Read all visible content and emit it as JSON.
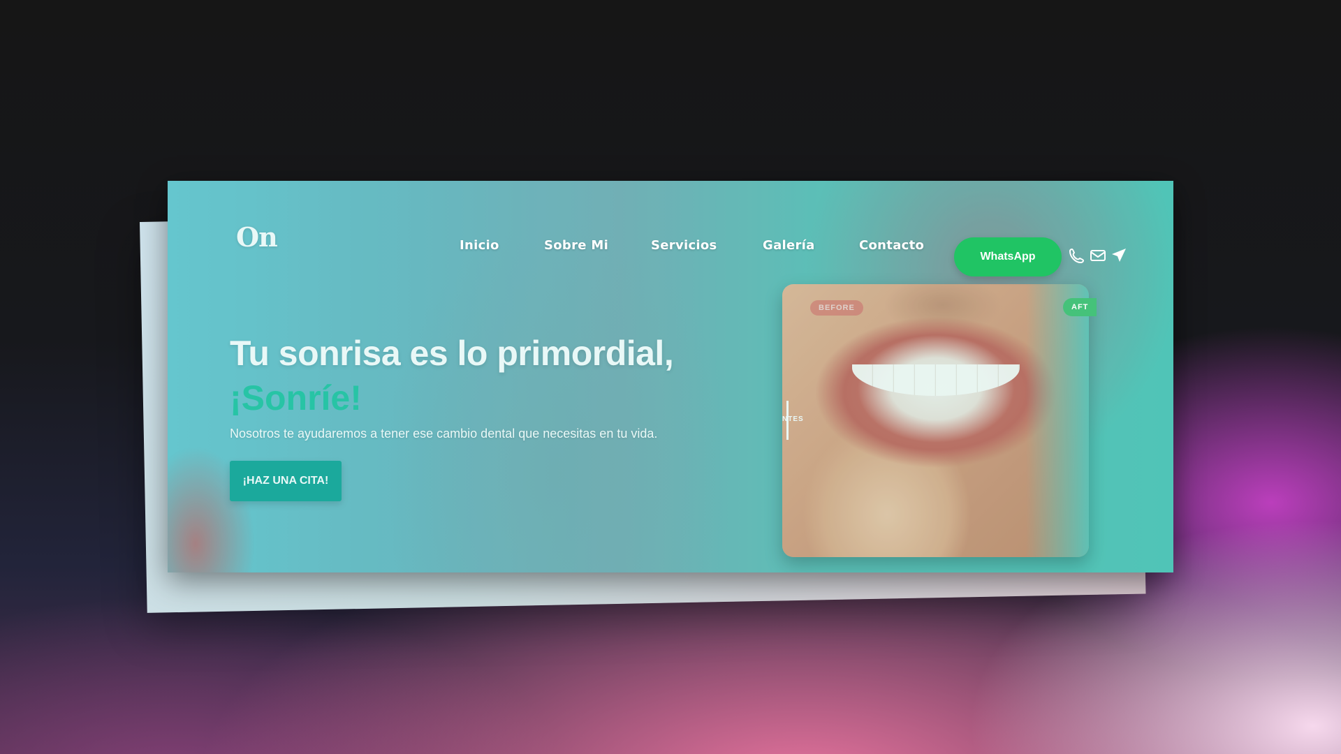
{
  "logo": "On",
  "nav": {
    "items": [
      {
        "label": "Inicio"
      },
      {
        "label": "Sobre Mi"
      },
      {
        "label": "Servicios"
      },
      {
        "label": "Galería"
      },
      {
        "label": "Contacto"
      }
    ],
    "whatsapp_label": "WhatsApp"
  },
  "contact_icons": [
    "phone-icon",
    "mail-icon",
    "send-icon"
  ],
  "hero": {
    "headline": "Tu sonrisa es lo primordial,",
    "accent": "¡Sonríe!",
    "subtext": "Nosotros te ayudaremos a tener ese cambio dental que necesitas en tu vida.",
    "cta_label": "¡HAZ UNA CITA!"
  },
  "comparison": {
    "before_label": "BEFORE",
    "after_label": "AFT",
    "slider_label": "NTES"
  },
  "colors": {
    "accent": "#27c6a4",
    "whatsapp": "#20c464",
    "cta": "#1aa79a"
  }
}
